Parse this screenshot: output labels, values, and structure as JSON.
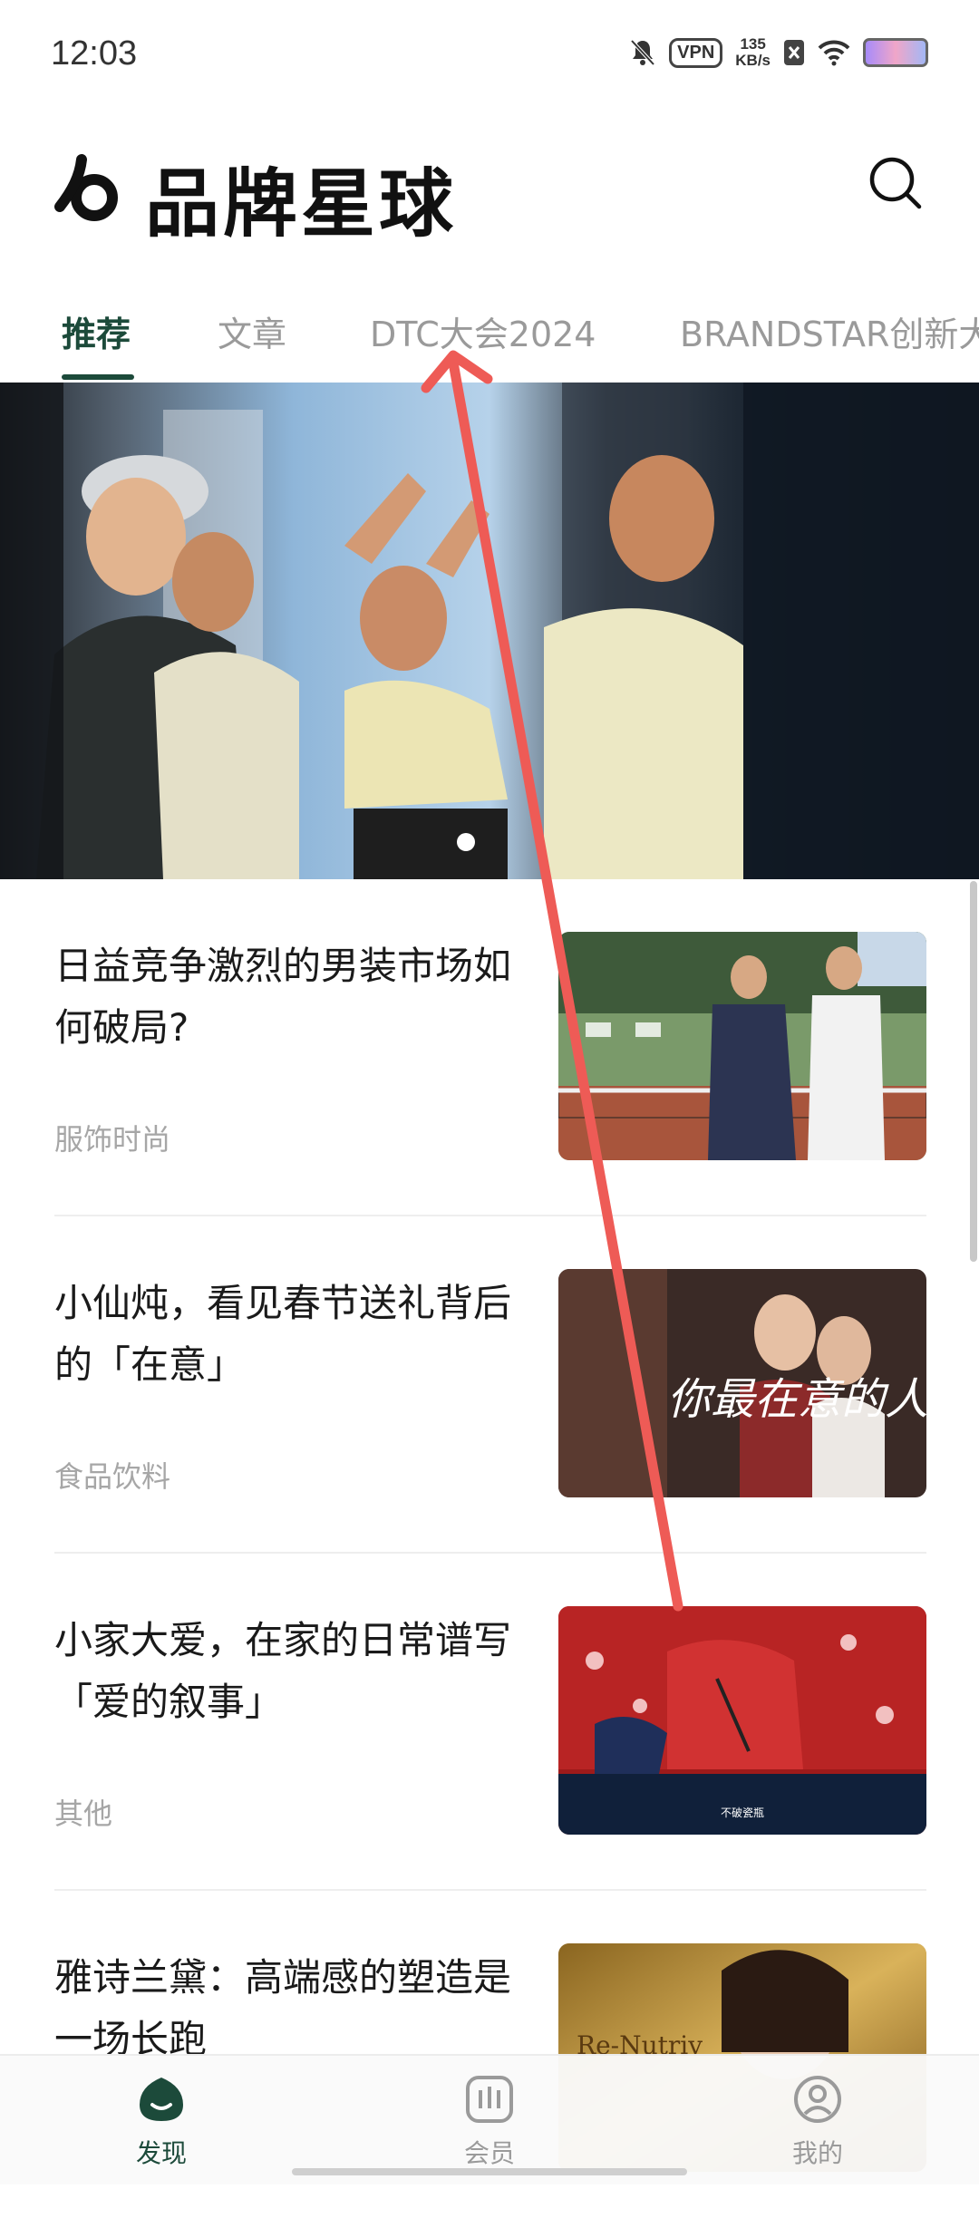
{
  "status_bar": {
    "time": "12:03",
    "vpn": "VPN",
    "speed_value": "135",
    "speed_unit": "KB/s"
  },
  "header": {
    "title": "品牌星球"
  },
  "tabs": [
    {
      "label": "推荐",
      "active": true
    },
    {
      "label": "文章",
      "active": false
    },
    {
      "label": "DTC大会2024",
      "active": false
    },
    {
      "label": "BRANDSTAR创新大",
      "active": false
    }
  ],
  "banner": {
    "page_count": 1,
    "active_index": 0
  },
  "feed": [
    {
      "title": "日益竞争激烈的男装市场如何破局?",
      "category": "服饰时尚"
    },
    {
      "title": "小仙炖，看见春节送礼背后的「在意」",
      "category": "食品饮料",
      "thumb_text": "你最在意的人"
    },
    {
      "title": "小家大爱，在家的日常谱写「爱的叙事」",
      "category": "其他",
      "thumb_text": "不破瓷瓶"
    },
    {
      "title": "雅诗兰黛：高端感的塑造是一场长跑",
      "category": "",
      "thumb_text": "Re-Nutriv"
    }
  ],
  "bottom_nav": [
    {
      "label": "发现",
      "icon": "discover-icon",
      "active": true
    },
    {
      "label": "会员",
      "icon": "member-icon",
      "active": false
    },
    {
      "label": "我的",
      "icon": "profile-icon",
      "active": false
    }
  ],
  "colors": {
    "brand": "#1c4a3a",
    "annotation_arrow": "#ee5b56"
  }
}
